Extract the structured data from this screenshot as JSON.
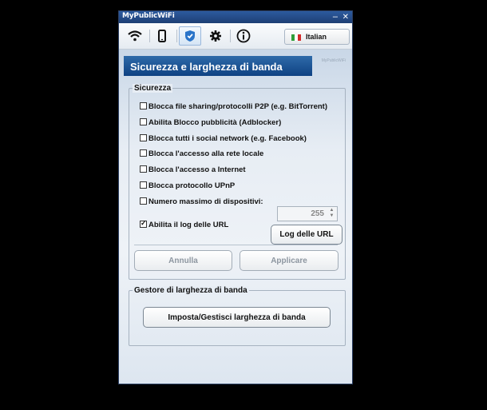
{
  "window": {
    "title": "MyPublicWiFi",
    "min": "–",
    "close": "✕"
  },
  "toolbar": {
    "icons": [
      "wifi-icon",
      "phone-icon",
      "shield-icon",
      "gear-icon",
      "info-icon"
    ],
    "active": "shield-icon",
    "language": "Italian",
    "flag_colors": [
      "#2f9e3a",
      "#ffffff",
      "#d42a2a"
    ]
  },
  "header": {
    "title": "Sicurezza e larghezza di banda",
    "brand": "MyPublicWiFi"
  },
  "security": {
    "legend": "Sicurezza",
    "options": [
      {
        "label": "Blocca file sharing/protocolli P2P (e.g. BitTorrent)",
        "checked": false
      },
      {
        "label": "Abilita Blocco pubblicità (Adblocker)",
        "checked": false
      },
      {
        "label": "Blocca tutti i social network (e.g. Facebook)",
        "checked": false
      },
      {
        "label": "Blocca l'accesso alla rete locale",
        "checked": false
      },
      {
        "label": "Blocca l'accesso a Internet",
        "checked": false
      },
      {
        "label": "Blocca protocollo UPnP",
        "checked": false
      }
    ],
    "max_devices_label": "Numero massimo di dispositivi:",
    "max_devices_checked": false,
    "max_devices_value": "255",
    "url_log_label": "Abilita il log delle URL",
    "url_log_checked": true,
    "url_log_button": "Log delle URL",
    "cancel": "Annulla",
    "apply": "Applicare"
  },
  "bandwidth": {
    "legend": "Gestore di larghezza di banda",
    "button": "Imposta/Gestisci larghezza di banda"
  },
  "colors": {
    "header_band": "#1a4f8f",
    "accent_shield": "#2a74c9"
  }
}
